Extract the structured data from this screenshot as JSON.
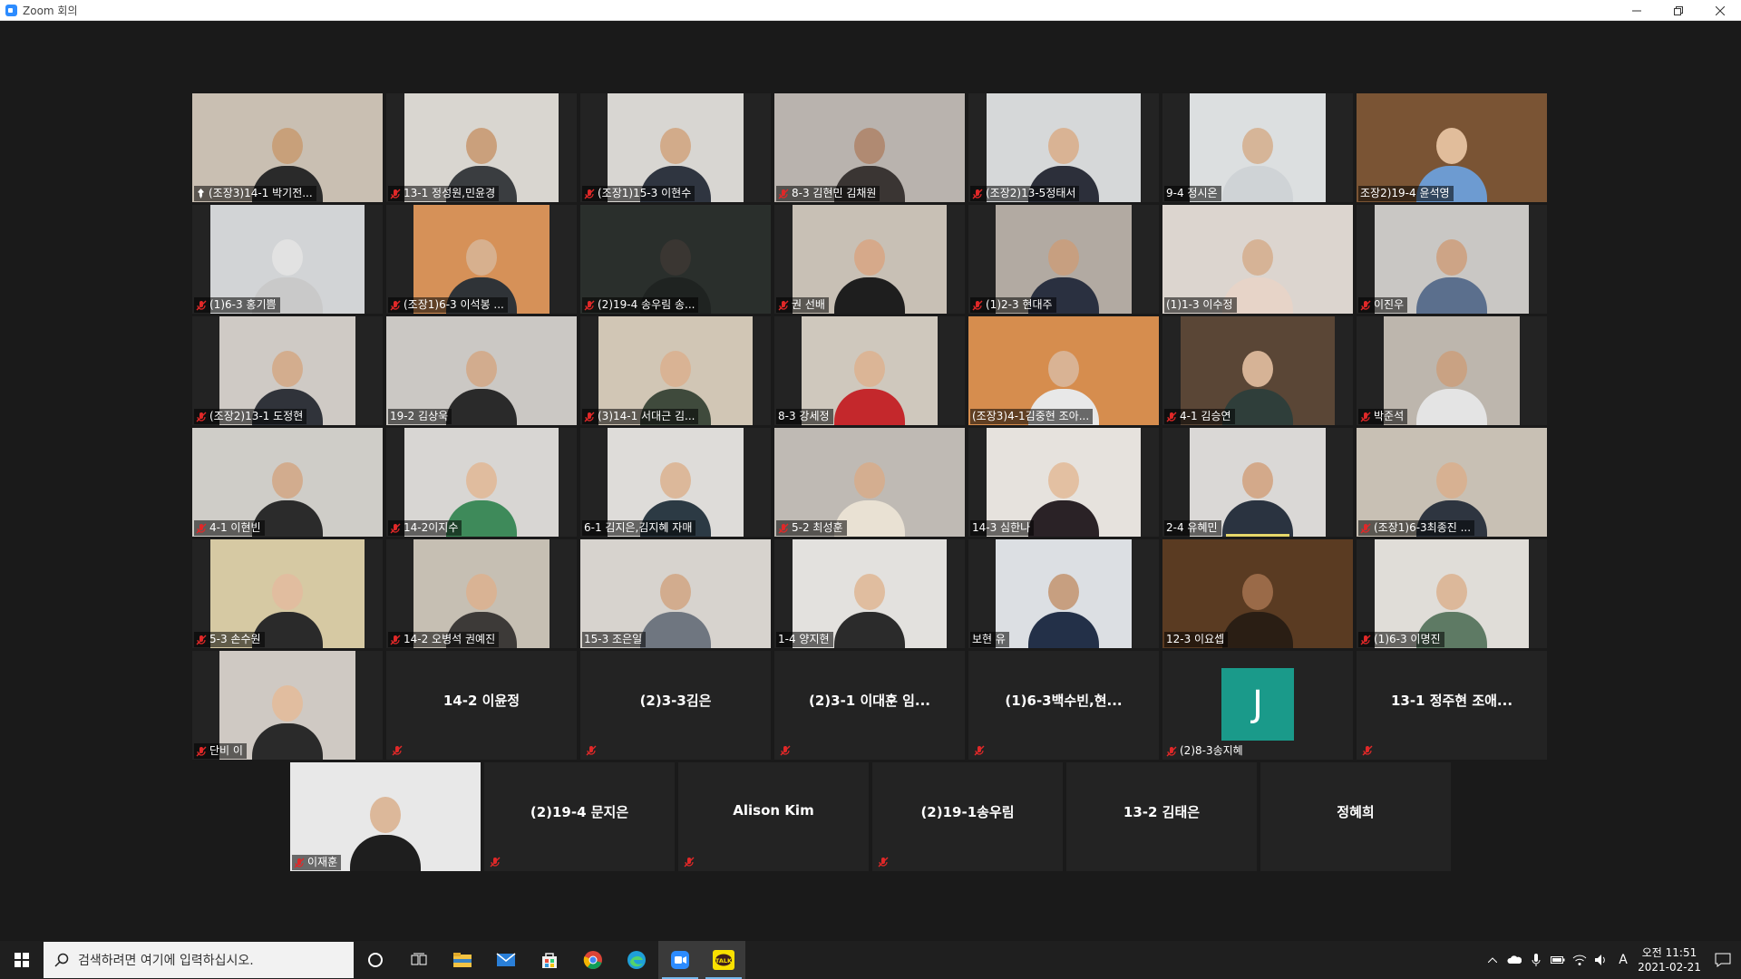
{
  "window": {
    "title": "Zoom 회의",
    "controls": [
      "minimize",
      "restore",
      "close"
    ]
  },
  "colors": {
    "mic_muted": "#e02828",
    "active_speaker": "#b5e61d",
    "avatar_j": "#1a9a8a",
    "background": "#1a1a1a",
    "tile": "#232323"
  },
  "participants": [
    {
      "name": "(조장3)14-1 박기전...",
      "video": true,
      "muted": false,
      "pinned": true,
      "active": true,
      "bg": "#c9bfb2",
      "skin": "#c8a07a",
      "shirt": "#2a2a2a",
      "icon": "pin-icon"
    },
    {
      "name": "13-1 정성원,민윤경",
      "video": true,
      "muted": true,
      "bg": "#d9d6d0",
      "skin": "#caa07c",
      "shirt": "#3a3d40"
    },
    {
      "name": "(조장1)15-3 이현수",
      "video": true,
      "muted": true,
      "bg": "#d8d6d2",
      "skin": "#d2ab8a",
      "shirt": "#2f3540"
    },
    {
      "name": "8-3 김현민 김채원",
      "video": true,
      "muted": true,
      "bg": "#b9b3ae",
      "skin": "#b08a72",
      "shirt": "#3a3533"
    },
    {
      "name": "(조장2)13-5정태서",
      "video": true,
      "muted": true,
      "bg": "#d6d8d9",
      "skin": "#d9b394",
      "shirt": "#2c2f3a"
    },
    {
      "name": "9-4 정시온",
      "video": true,
      "muted": false,
      "bg": "#dcdfe0",
      "skin": "#d6b598",
      "shirt": "#cfd3d6"
    },
    {
      "name": "조장2)19-4 윤석영",
      "video": true,
      "muted": false,
      "bg": "#7a5434",
      "skin": "#e1bd9b",
      "shirt": "#6d9bd1"
    },
    {
      "name": "(1)6-3 홍기쁨",
      "video": true,
      "muted": true,
      "bg": "#d2d4d6",
      "skin": "#e2e2e2",
      "shirt": "#c9c9c9"
    },
    {
      "name": "(조장1)6-3 이석봉 ...",
      "video": true,
      "muted": true,
      "bg": "#d69158",
      "skin": "#d7b08e",
      "shirt": "#2f3337"
    },
    {
      "name": "(2)19-4 송우림 송...",
      "video": true,
      "muted": true,
      "bg": "#2a2f2c",
      "skin": "#3a3632",
      "shirt": "#1f2321"
    },
    {
      "name": "권 선배",
      "video": true,
      "muted": true,
      "bg": "#c8c0b5",
      "skin": "#d6a98a",
      "shirt": "#1e1e1e"
    },
    {
      "name": "(1)2-3 현대주",
      "video": true,
      "muted": true,
      "bg": "#b2aaa2",
      "skin": "#c79f80",
      "shirt": "#2a3040"
    },
    {
      "name": "(1)1-3 이수정",
      "video": true,
      "muted": false,
      "bg": "#dcd5cf",
      "skin": "#d6b396",
      "shirt": "#e7d4c8"
    },
    {
      "name": "이진우",
      "video": true,
      "muted": true,
      "bg": "#c9c7c4",
      "skin": "#cda486",
      "shirt": "#5b6f8d"
    },
    {
      "name": "(조장2)13-1 도정현",
      "video": true,
      "muted": true,
      "bg": "#cfcac5",
      "skin": "#d3ad8e",
      "shirt": "#30333a"
    },
    {
      "name": "19-2 김상욱",
      "video": true,
      "muted": false,
      "bg": "#cbc8c4",
      "skin": "#d2ac8e",
      "shirt": "#2a2a2a"
    },
    {
      "name": "(3)14-1 서대근 김...",
      "video": true,
      "muted": true,
      "bg": "#d1c6b5",
      "skin": "#d9b394",
      "shirt": "#3f4a3c"
    },
    {
      "name": "8-3 강세정",
      "video": true,
      "muted": false,
      "bg": "#cfc8bd",
      "skin": "#dbb596",
      "shirt": "#c4282c"
    },
    {
      "name": "(조장3)4-1김중현 조아...",
      "video": true,
      "muted": false,
      "bg": "#d68d4e",
      "skin": "#d9b394",
      "shirt": "#e8e8e8"
    },
    {
      "name": "4-1 김승연",
      "video": true,
      "muted": true,
      "bg": "#5a4636",
      "skin": "#d6b396",
      "shirt": "#2f3e3a"
    },
    {
      "name": "박준석",
      "video": true,
      "muted": true,
      "bg": "#bdb6ad",
      "skin": "#c9a283",
      "shirt": "#e4e4e4"
    },
    {
      "name": "4-1 이현빈",
      "video": true,
      "muted": true,
      "bg": "#cfcdc8",
      "skin": "#d2ac8e",
      "shirt": "#2b2b2b"
    },
    {
      "name": "14-2이지수",
      "video": true,
      "muted": true,
      "bg": "#d8d6d3",
      "skin": "#e0bc9e",
      "shirt": "#3e8a5a"
    },
    {
      "name": "6-1 김지은,김지혜 자매",
      "video": true,
      "muted": false,
      "bg": "#dedcd9",
      "skin": "#dcb89a",
      "shirt": "#2c3a44"
    },
    {
      "name": "5-2 최성훈",
      "video": true,
      "muted": true,
      "bg": "#bfbab4",
      "skin": "#d4ae90",
      "shirt": "#e9e1d3"
    },
    {
      "name": "14-3 심한나",
      "video": true,
      "muted": false,
      "bg": "#e6e2dd",
      "skin": "#e3c0a2",
      "shirt": "#2a2226"
    },
    {
      "name": "2-4 유혜민",
      "video": true,
      "muted": false,
      "bg": "#dad8d6",
      "skin": "#d3a98a",
      "shirt": "#2a3340",
      "speaking": true
    },
    {
      "name": "(조장1)6-3최종진 ...",
      "video": true,
      "muted": true,
      "bg": "#c8c0b4",
      "skin": "#d7b192",
      "shirt": "#2e3540"
    },
    {
      "name": "5-3 손수원",
      "video": true,
      "muted": true,
      "bg": "#d6c9a3",
      "skin": "#e1bd9f",
      "shirt": "#2a2a2a"
    },
    {
      "name": "14-2 오병석 권예진",
      "video": true,
      "muted": true,
      "bg": "#c6bfb3",
      "skin": "#d9b394",
      "shirt": "#3d3a38"
    },
    {
      "name": "15-3 조은일",
      "video": true,
      "muted": false,
      "bg": "#d7d3ce",
      "skin": "#d2ac8e",
      "shirt": "#6f7680"
    },
    {
      "name": "1-4 양지현",
      "video": true,
      "muted": false,
      "bg": "#e3e1de",
      "skin": "#e0bd9f",
      "shirt": "#2b2b2b"
    },
    {
      "name": "보현 유",
      "video": true,
      "muted": false,
      "bg": "#dcdfe3",
      "skin": "#c79f80",
      "shirt": "#233048"
    },
    {
      "name": "12-3 이요셉",
      "video": true,
      "muted": false,
      "bg": "#5a3b22",
      "skin": "#9a6a48",
      "shirt": "#2a1e14"
    },
    {
      "name": "(1)6-3 이명진",
      "video": true,
      "muted": true,
      "bg": "#e0ddd8",
      "skin": "#dcb89a",
      "shirt": "#5e7a64"
    },
    {
      "name": "단비 이",
      "video": true,
      "muted": true,
      "bg": "#cfc9c3",
      "skin": "#e1bd9f",
      "shirt": "#2a2a2a"
    },
    {
      "name": "14-2 이윤정",
      "video": false,
      "muted": true
    },
    {
      "name": "(2)3-3김은",
      "video": false,
      "muted": true
    },
    {
      "name": "(2)3-1 이대훈 임...",
      "video": false,
      "muted": true
    },
    {
      "name": "(1)6-3백수빈,현...",
      "video": false,
      "muted": true
    },
    {
      "name": "(2)8-3송지혜",
      "video": false,
      "muted": true,
      "avatar": "J"
    },
    {
      "name": "13-1 정주현 조애...",
      "video": false,
      "muted": true
    },
    {
      "name": "이재훈",
      "video": true,
      "muted": true,
      "bg": "#e8e8e8",
      "skin": "#dcb89a",
      "shirt": "#1e1e1e"
    },
    {
      "name": "(2)19-4 문지은",
      "video": false,
      "muted": true
    },
    {
      "name": "Alison Kim",
      "video": false,
      "muted": true
    },
    {
      "name": "(2)19-1송우림",
      "video": false,
      "muted": true
    },
    {
      "name": "13-2 김태은",
      "video": false,
      "muted": false
    },
    {
      "name": "정혜희",
      "video": false,
      "muted": false
    }
  ],
  "taskbar": {
    "search_placeholder": "검색하려면 여기에 입력하십시오.",
    "apps": [
      "cortana-icon",
      "task-view-icon",
      "file-explorer-icon",
      "mail-icon",
      "store-icon",
      "chrome-icon",
      "edge-icon",
      "zoom-icon",
      "kakaotalk-icon"
    ],
    "kakao_label": "TALK",
    "ime": "A",
    "time": "오전 11:51",
    "date": "2021-02-21"
  }
}
